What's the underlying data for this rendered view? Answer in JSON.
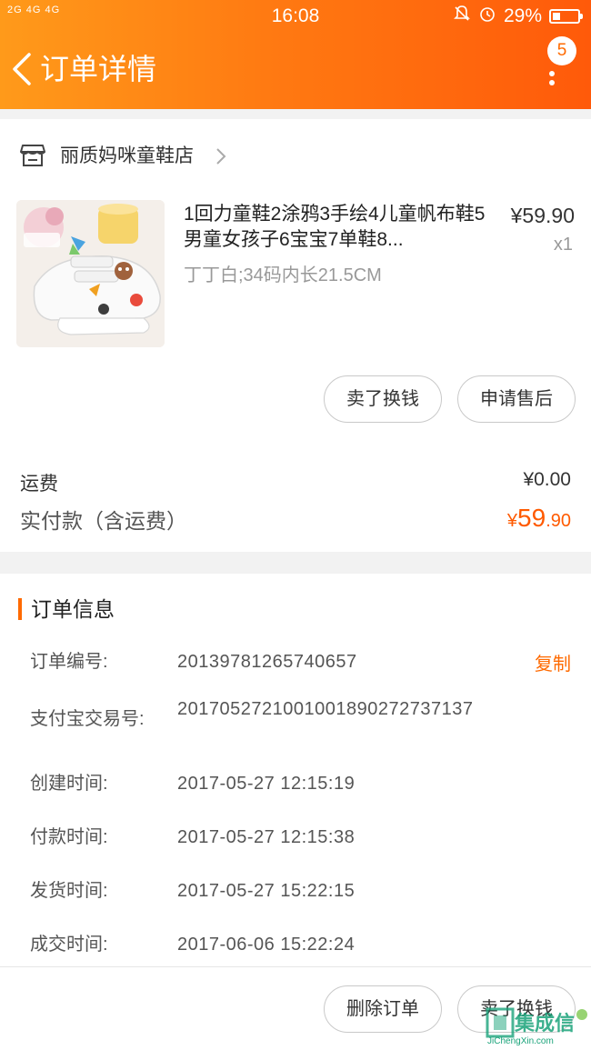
{
  "status_bar": {
    "signal": "2G 4G 4G",
    "time": "16:08",
    "battery": "29%"
  },
  "nav": {
    "title": "订单详情",
    "badge_count": "5"
  },
  "store": {
    "name": "丽质妈咪童鞋店"
  },
  "product": {
    "title": "1回力童鞋2涂鸦3手绘4儿童帆布鞋5男童女孩子6宝宝7单鞋8...",
    "sku": "丁丁白;34码内长21.5CM",
    "price": "¥59.90",
    "quantity": "x1",
    "actions": [
      "卖了换钱",
      "申请售后"
    ]
  },
  "summary": {
    "shipping_label": "运费",
    "shipping_value": "¥0.00",
    "paid_label": "实付款（含运费）",
    "paid_currency": "¥",
    "paid_integer": "59",
    "paid_decimal": ".90"
  },
  "order_info": {
    "section_title": "订单信息",
    "copy_label": "复制",
    "rows": [
      {
        "label": "订单编号:",
        "value": "20139781265740657"
      },
      {
        "label": "支付宝交易号:",
        "value": "2017052721001001890272737137"
      },
      {
        "label": "创建时间:",
        "value": "2017-05-27 12:15:19"
      },
      {
        "label": "付款时间:",
        "value": "2017-05-27 12:15:38"
      },
      {
        "label": "发货时间:",
        "value": "2017-05-27 15:22:15"
      },
      {
        "label": "成交时间:",
        "value": "2017-06-06 15:22:24"
      }
    ]
  },
  "bottom_actions": [
    "删除订单",
    "卖了换钱"
  ],
  "watermark": {
    "text": "集成信",
    "url": "JiChengXin.com"
  },
  "colors": {
    "accent": "#ff6a00",
    "header_start": "#ff9a1a",
    "header_end": "#ff5a0a"
  }
}
